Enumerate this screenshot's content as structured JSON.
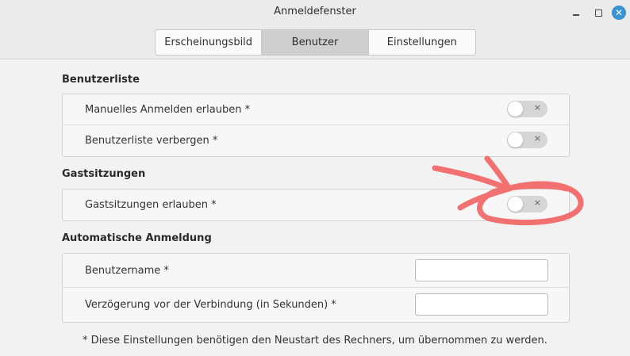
{
  "window": {
    "title": "Anmeldefenster",
    "close_glyph": "✕"
  },
  "tabs": [
    {
      "label": "Erscheinungsbild",
      "active": false
    },
    {
      "label": "Benutzer",
      "active": true
    },
    {
      "label": "Einstellungen",
      "active": false
    }
  ],
  "sections": {
    "user_list": {
      "title": "Benutzerliste",
      "rows": [
        {
          "label": "Manuelles Anmelden erlauben *",
          "toggle_on": false
        },
        {
          "label": "Benutzerliste verbergen *",
          "toggle_on": false
        }
      ]
    },
    "guest": {
      "title": "Gastsitzungen",
      "rows": [
        {
          "label": "Gastsitzungen erlauben *",
          "toggle_on": false
        }
      ]
    },
    "autologin": {
      "title": "Automatische Anmeldung",
      "rows": [
        {
          "label": "Benutzername *",
          "value": ""
        },
        {
          "label": "Verzögerung vor der Verbindung (in Sekunden) *",
          "value": ""
        }
      ]
    }
  },
  "toggle_off_glyph": "×",
  "footnote": "* Diese Einstellungen benötigen den Neustart des Rechners, um übernommen zu werden.",
  "annotation_color": "#f26a6a"
}
